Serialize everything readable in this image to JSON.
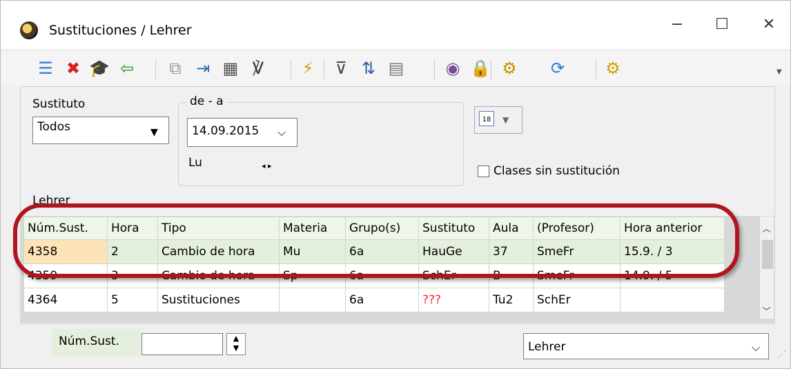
{
  "window": {
    "title": "Sustituciones / Lehrer",
    "controls": {
      "minimize": "−",
      "maximize": "☐",
      "close": "✕"
    }
  },
  "toolbar": {
    "buttons": [
      {
        "name": "list-icon",
        "glyph": "☰",
        "color": "#3a7bd5"
      },
      {
        "name": "delete-icon",
        "glyph": "✖",
        "color": "#d81f1f"
      },
      {
        "name": "graduation-cap-icon",
        "glyph": "🎓",
        "color": "#333333"
      },
      {
        "name": "import-icon",
        "glyph": "⇦",
        "color": "#2e8b2e"
      },
      {
        "name": "copy-icon",
        "glyph": "⧉",
        "color": "#9a9a9a"
      },
      {
        "name": "enter-icon",
        "glyph": "⇥",
        "color": "#2e6fb0"
      },
      {
        "name": "calculator-icon",
        "glyph": "▦",
        "color": "#555555"
      },
      {
        "name": "stethoscope-icon",
        "glyph": "℣",
        "color": "#333333"
      },
      {
        "name": "wand-icon",
        "glyph": "⚡",
        "color": "#c8a000"
      },
      {
        "name": "filter-icon",
        "glyph": "⊽",
        "color": "#444444"
      },
      {
        "name": "sort-icon",
        "glyph": "⇅",
        "color": "#3060a0"
      },
      {
        "name": "columns-icon",
        "glyph": "▤",
        "color": "#777777"
      },
      {
        "name": "color-icon",
        "glyph": "◉",
        "color": "#7a4a9a"
      },
      {
        "name": "lock-icon",
        "glyph": "🔒",
        "color": "#9a9a9a"
      },
      {
        "name": "report-settings-icon",
        "glyph": "⚙",
        "color": "#c89000"
      },
      {
        "name": "refresh-icon",
        "glyph": "⟳",
        "color": "#2e7bd5"
      },
      {
        "name": "settings-gear-icon",
        "glyph": "⚙",
        "color": "#d0a000"
      }
    ]
  },
  "filters": {
    "sustituto_label": "Sustituto",
    "sustituto_value": "Todos",
    "range_label": "de - a",
    "date_value": "14.09.2015",
    "weekday": "Lu",
    "nav_arrows": "◂ ▸",
    "calendar_icon_text": "18",
    "checkbox_label": "Clases sin sustitución",
    "grid_label": "Lehrer"
  },
  "table": {
    "columns": [
      "Núm.Sust.",
      "Hora",
      "Tipo",
      "Materia",
      "Grupo(s)",
      "Sustituto",
      "Aula",
      "(Profesor)",
      "Hora anterior"
    ],
    "rows": [
      [
        "4358",
        "2",
        "Cambio de hora",
        "Mu",
        "6a",
        "HauGe",
        "37",
        "SmeFr",
        "15.9. / 3"
      ],
      [
        "4359",
        "3",
        "Cambio de hora",
        "Sp",
        "6a",
        "SchEr",
        "B",
        "SmeFr",
        "14.9. / 5"
      ],
      [
        "4364",
        "5",
        "Sustituciones",
        "",
        "6a",
        "???",
        "Tu2",
        "SchEr",
        ""
      ]
    ]
  },
  "bottom": {
    "num_label": "Núm.Sust.",
    "num_value": "",
    "view_value": "Lehrer"
  }
}
